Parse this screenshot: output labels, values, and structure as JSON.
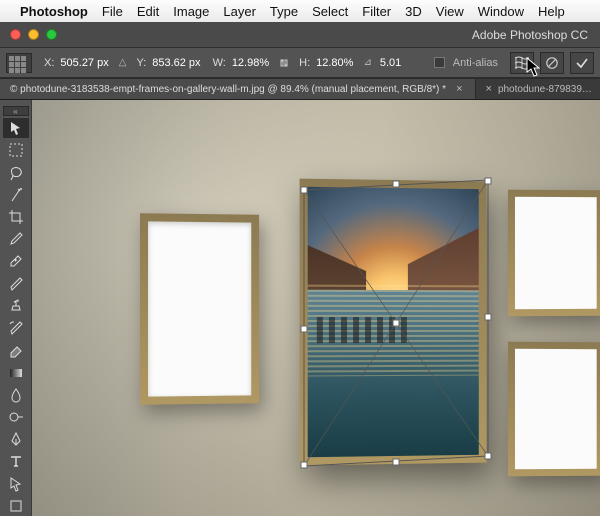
{
  "menubar": {
    "app": "Photoshop",
    "items": [
      "File",
      "Edit",
      "Image",
      "Layer",
      "Type",
      "Select",
      "Filter",
      "3D",
      "View",
      "Window",
      "Help"
    ]
  },
  "header": {
    "title": "Adobe Photoshop CC"
  },
  "options": {
    "x_value": "505.27 px",
    "y_value": "853.62 px",
    "w_value": "12.98%",
    "h_value": "12.80%",
    "angle_value": "5.01",
    "antialias_label": "Anti-alias"
  },
  "tabs": {
    "active": "© photodune-3183538-empt-frames-on-gallery-wall-m.jpg @ 89.4% (manual placement, RGB/8*) *",
    "inactive": "photodune-879839…"
  },
  "tools": [
    {
      "name": "move-tool"
    },
    {
      "name": "marquee-tool"
    },
    {
      "name": "lasso-tool"
    },
    {
      "name": "magic-wand-tool"
    },
    {
      "name": "crop-tool"
    },
    {
      "name": "eyedropper-tool"
    },
    {
      "name": "healing-brush-tool"
    },
    {
      "name": "brush-tool"
    },
    {
      "name": "clone-stamp-tool"
    },
    {
      "name": "history-brush-tool"
    },
    {
      "name": "eraser-tool"
    },
    {
      "name": "gradient-tool"
    },
    {
      "name": "blur-tool"
    },
    {
      "name": "dodge-tool"
    },
    {
      "name": "pen-tool"
    },
    {
      "name": "type-tool"
    },
    {
      "name": "path-select-tool"
    },
    {
      "name": "shape-tool"
    }
  ]
}
